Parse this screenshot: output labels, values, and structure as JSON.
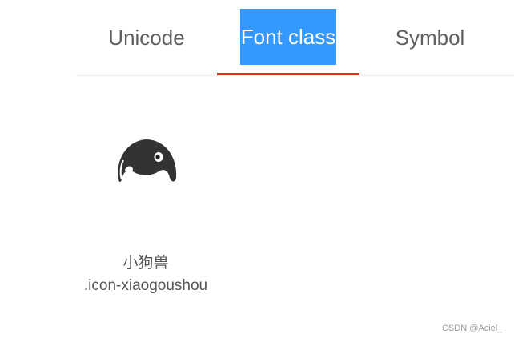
{
  "tabs": [
    {
      "label": "Unicode",
      "selected": false
    },
    {
      "label": "Font class",
      "selected": true
    },
    {
      "label": "Symbol",
      "selected": false
    }
  ],
  "colors": {
    "selected_tab_bg": "#3399ff",
    "underline": "#e2231a",
    "text": "#5f5f5f"
  },
  "icon": {
    "semantic": "xiaogoushou-icon",
    "name": "小狗兽",
    "class_name": ".icon-xiaogoushou"
  },
  "watermark": "CSDN @Aciel_"
}
